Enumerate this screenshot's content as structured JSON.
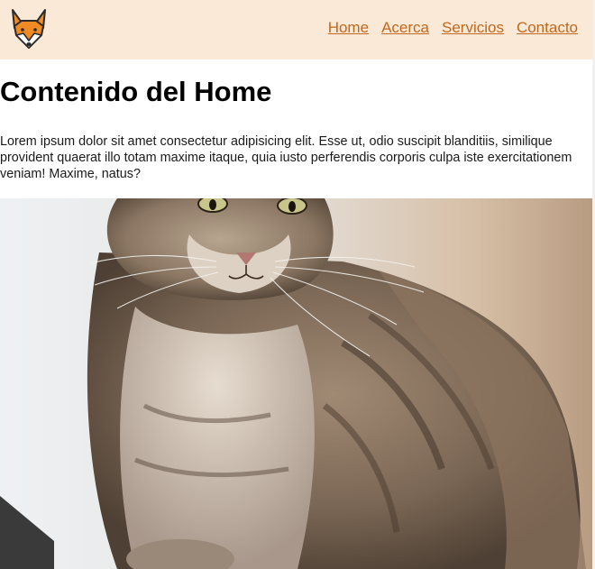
{
  "header": {
    "logo_icon": "fox-logo-icon",
    "background_color": "#fbe9d7",
    "link_color": "#c2671c",
    "nav": [
      {
        "label": "Home"
      },
      {
        "label": "Acerca"
      },
      {
        "label": "Servicios"
      },
      {
        "label": "Contacto"
      }
    ]
  },
  "main": {
    "title": "Contenido del Home",
    "paragraph": "Lorem ipsum dolor sit amet consectetur adipisicing elit. Esse ut, odio suscipit blanditiis, similique provident quaerat illo totam maxime itaque, quia iusto perferendis corporis culpa iste exercitationem veniam! Maxime, natus?",
    "image_subject": "tabby-cat-photo"
  }
}
